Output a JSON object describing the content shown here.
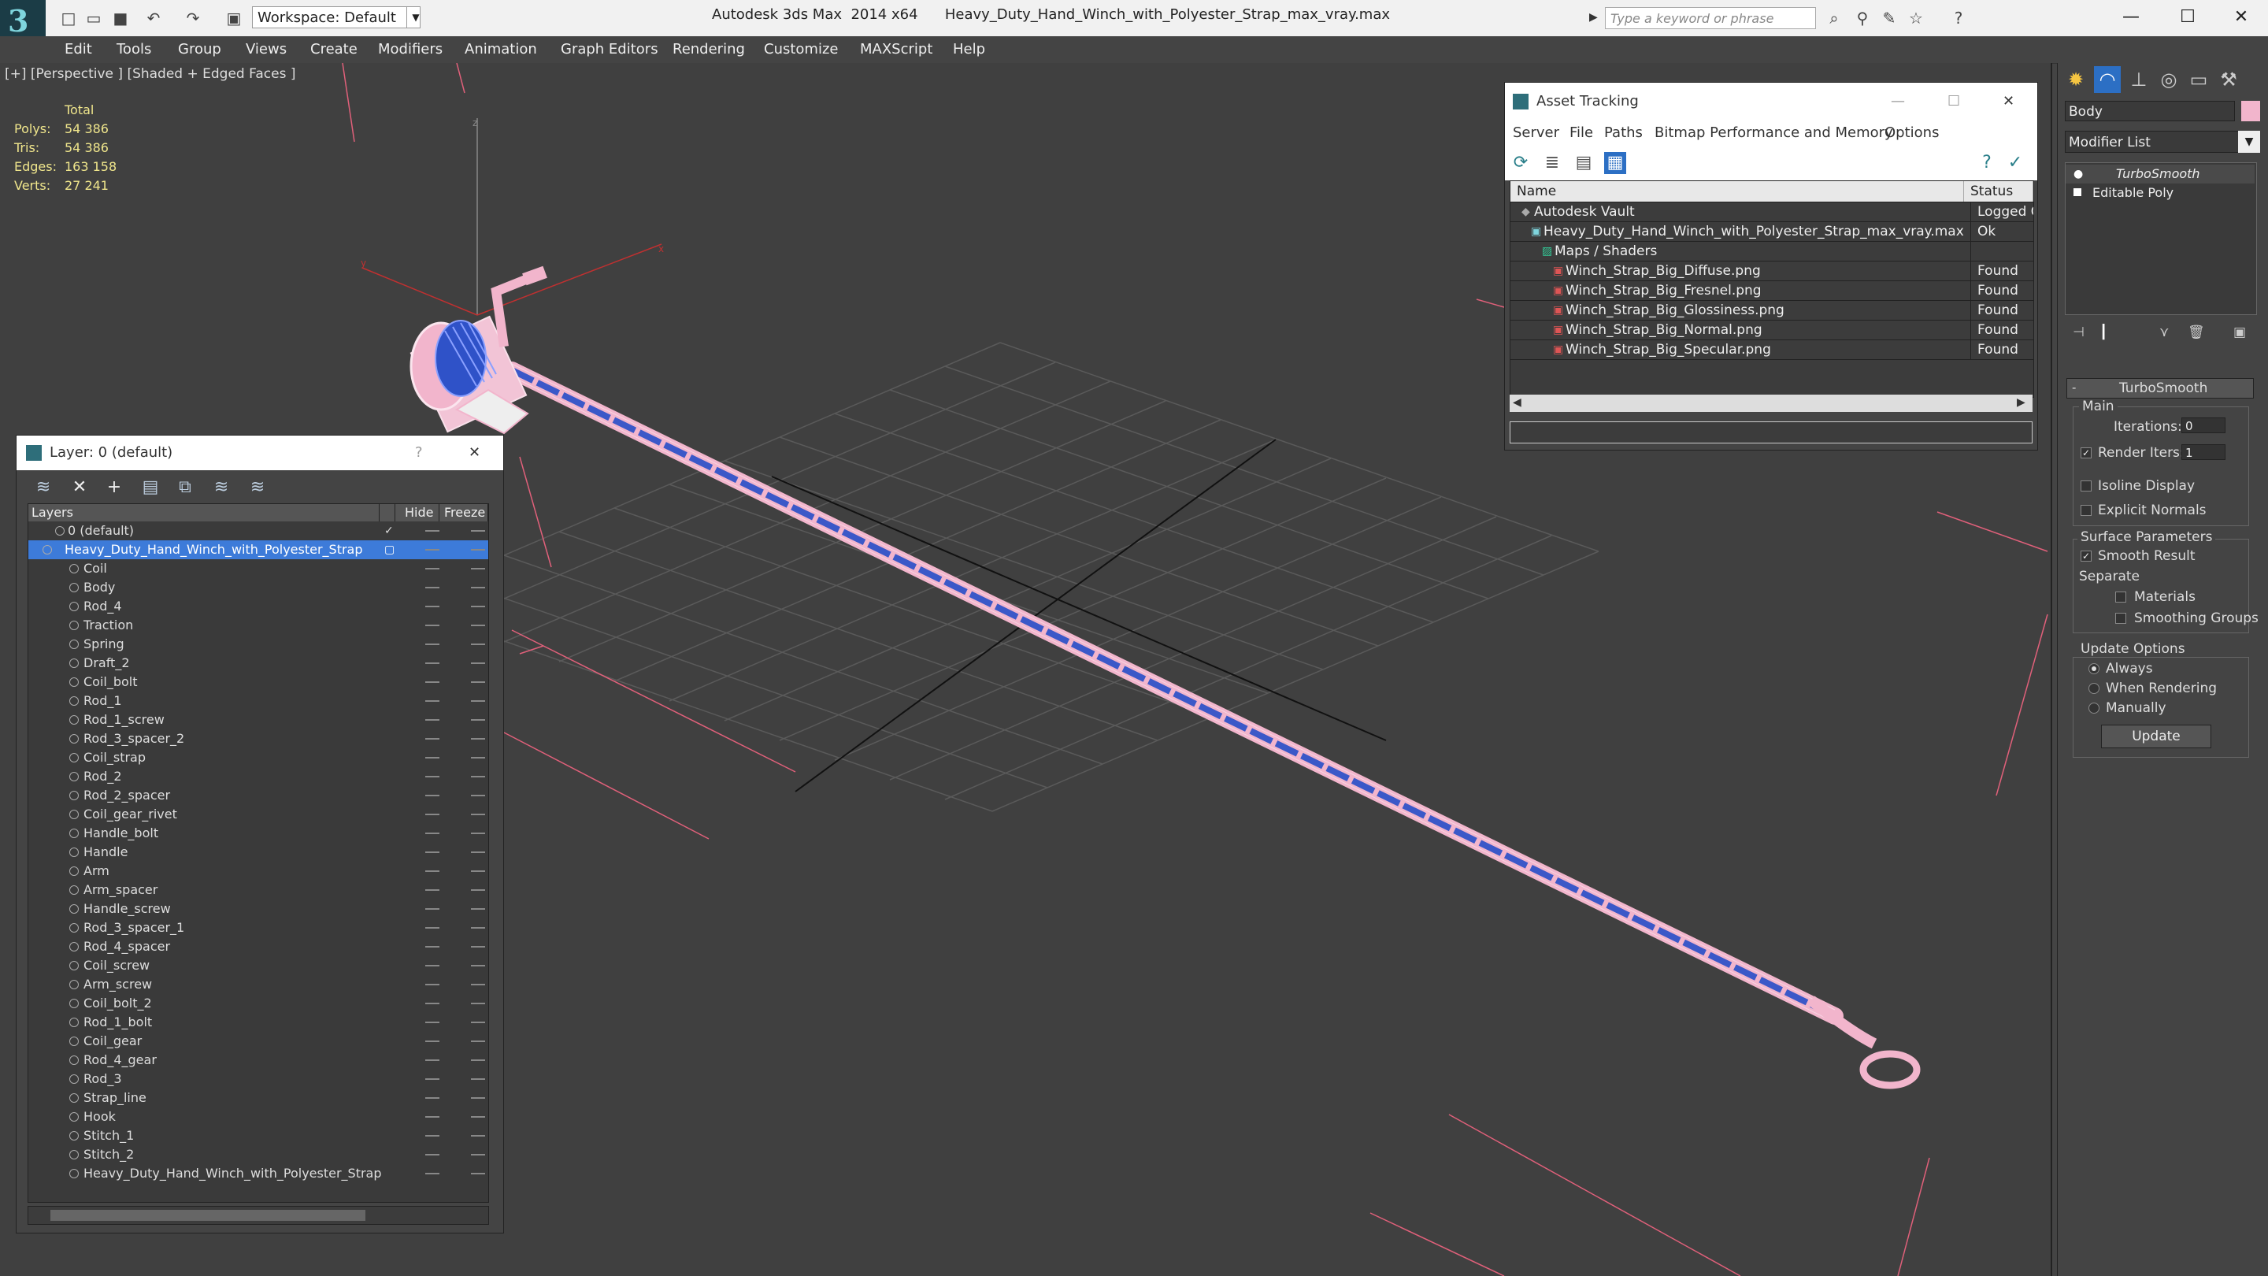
{
  "app": {
    "title": "Autodesk 3ds Max  2014 x64      Heavy_Duty_Hand_Winch_with_Polyester_Strap_max_vray.max",
    "workspace": "Workspace: Default",
    "search_placeholder": "Type a keyword or phrase",
    "logo_glyph": "3"
  },
  "window_controls": {
    "minimize": "—",
    "maximize": "☐",
    "close": "✕"
  },
  "menu": [
    "Edit",
    "Tools",
    "Group",
    "Views",
    "Create",
    "Modifiers",
    "Animation",
    "Graph Editors",
    "Rendering",
    "Customize",
    "MAXScript",
    "Help"
  ],
  "viewport": {
    "label": "[+] [Perspective ] [Shaded + Edged Faces ]",
    "stats": {
      "header": "Total",
      "rows": [
        {
          "label": "Polys:",
          "value": "54 386"
        },
        {
          "label": "Tris:",
          "value": "54 386"
        },
        {
          "label": "Edges:",
          "value": "163 158"
        },
        {
          "label": "Verts:",
          "value": "27 241"
        }
      ]
    },
    "axis_labels": {
      "z": "z",
      "x": "x",
      "y": "y"
    }
  },
  "layer_panel": {
    "title": "Layer: 0 (default)",
    "help": "?",
    "close": "✕",
    "columns": {
      "layers": "Layers",
      "hide": "Hide",
      "freeze": "Freeze"
    },
    "default_layer": "0 (default)",
    "selected_layer": "Heavy_Duty_Hand_Winch_with_Polyester_Strap",
    "objects": [
      "Coil",
      "Body",
      "Rod_4",
      "Traction",
      "Spring",
      "Draft_2",
      "Coil_bolt",
      "Rod_1",
      "Rod_1_screw",
      "Rod_3_spacer_2",
      "Coil_strap",
      "Rod_2",
      "Rod_2_spacer",
      "Coil_gear_rivet",
      "Handle_bolt",
      "Handle",
      "Arm",
      "Arm_spacer",
      "Handle_screw",
      "Rod_3_spacer_1",
      "Rod_4_spacer",
      "Coil_screw",
      "Arm_screw",
      "Coil_bolt_2",
      "Rod_1_bolt",
      "Coil_gear",
      "Rod_4_gear",
      "Rod_3",
      "Strap_line",
      "Hook",
      "Stitch_1",
      "Stitch_2",
      "Heavy_Duty_Hand_Winch_with_Polyester_Strap"
    ]
  },
  "asset_tracking": {
    "title": "Asset Tracking",
    "menu": [
      "Server",
      "File",
      "Paths",
      "Bitmap Performance and Memory",
      "Options"
    ],
    "columns": {
      "name": "Name",
      "status": "Status"
    },
    "rows": [
      {
        "name": "Autodesk Vault",
        "status": "Logged O"
      },
      {
        "name": "Heavy_Duty_Hand_Winch_with_Polyester_Strap_max_vray.max",
        "status": "Ok"
      },
      {
        "name": "Maps / Shaders",
        "status": ""
      },
      {
        "name": "Winch_Strap_Big_Diffuse.png",
        "status": "Found"
      },
      {
        "name": "Winch_Strap_Big_Fresnel.png",
        "status": "Found"
      },
      {
        "name": "Winch_Strap_Big_Glossiness.png",
        "status": "Found"
      },
      {
        "name": "Winch_Strap_Big_Normal.png",
        "status": "Found"
      },
      {
        "name": "Winch_Strap_Big_Specular.png",
        "status": "Found"
      }
    ]
  },
  "command_panel": {
    "object_name": "Body",
    "object_color": "#f2b5cc",
    "modifier_list": "Modifier List",
    "stack": [
      "TurboSmooth",
      "Editable Poly"
    ],
    "rollout_title": "TurboSmooth",
    "main": {
      "group": "Main",
      "iterations_label": "Iterations:",
      "iterations": "0",
      "render_iters_label": "Render Iters:",
      "render_iters": "1",
      "isoline": "Isoline Display",
      "explicit_normals": "Explicit Normals"
    },
    "surface": {
      "group": "Surface Parameters",
      "smooth_result": "Smooth Result",
      "separate": "Separate",
      "materials": "Materials",
      "smoothing_groups": "Smoothing Groups"
    },
    "update": {
      "group": "Update Options",
      "always": "Always",
      "when_rendering": "When Rendering",
      "manually": "Manually",
      "button": "Update"
    }
  },
  "colors": {
    "viewport_bg": "#404040",
    "wire_pink": "#f2b5cc",
    "strap_blue": "#3b58c8",
    "selection": "#3d7bd9",
    "grid": "#5a5a5a",
    "stats_yellow": "#f0e68c"
  }
}
